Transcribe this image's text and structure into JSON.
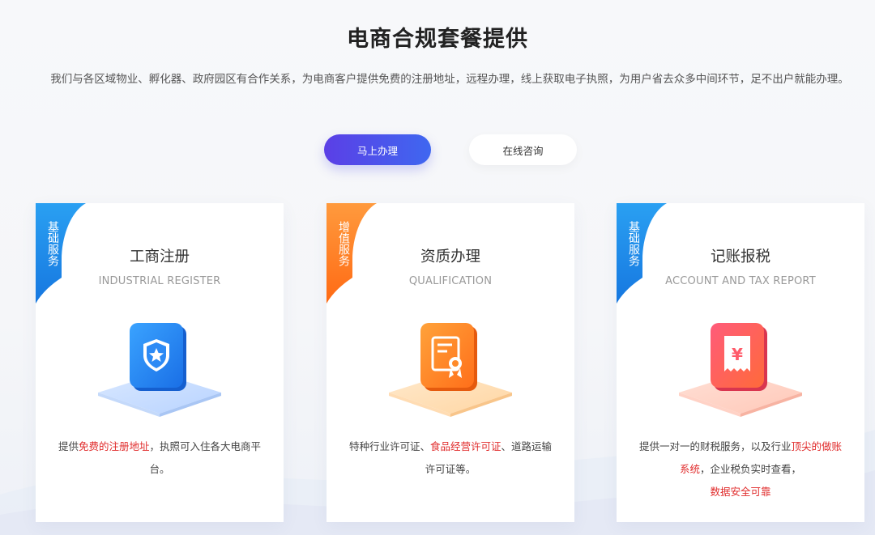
{
  "header": {
    "title": "电商合规套餐提供",
    "subtitle": "我们与各区域物业、孵化器、政府园区有合作关系，为电商客户提供免费的注册地址，远程办理，线上获取电子执照，为用户省去众多中间环节，足不出户就能办理。"
  },
  "actions": {
    "primary_label": "马上办理",
    "secondary_label": "在线咨询"
  },
  "colors": {
    "primary_gradient": [
      "#5b3fe6",
      "#3f67f0"
    ],
    "tag_blue": "#1f8fe8",
    "tag_orange": "#ff7a1f",
    "highlight": "#e02b2b"
  },
  "cards": [
    {
      "tag": "基础服务",
      "title": "工商注册",
      "subtitle": "INDUSTRIAL REGISTER",
      "icon": "shield-star-icon",
      "desc": [
        {
          "t": "提供",
          "hl": false
        },
        {
          "t": "免费的注册地址",
          "hl": true
        },
        {
          "t": "，执照可入住各大电商平台。",
          "hl": false
        }
      ]
    },
    {
      "tag": "增值服务",
      "title": "资质办理",
      "subtitle": "QUALIFICATION",
      "icon": "certificate-icon",
      "desc": [
        {
          "t": "特种行业许可证、",
          "hl": false
        },
        {
          "t": "食品经营许可证",
          "hl": true
        },
        {
          "t": "、道路运输许可证等。",
          "hl": false
        }
      ]
    },
    {
      "tag": "基础服务",
      "title": "记账报税",
      "subtitle": "ACCOUNT AND TAX REPORT",
      "icon": "yuan-receipt-icon",
      "desc": [
        {
          "t": "提供一对一的财税服务，以及行业",
          "hl": false
        },
        {
          "t": "顶尖的做账系统",
          "hl": true
        },
        {
          "t": "，企业税负实时查看，",
          "hl": false
        },
        {
          "t": "数据安全可靠",
          "hl": true
        }
      ]
    }
  ]
}
